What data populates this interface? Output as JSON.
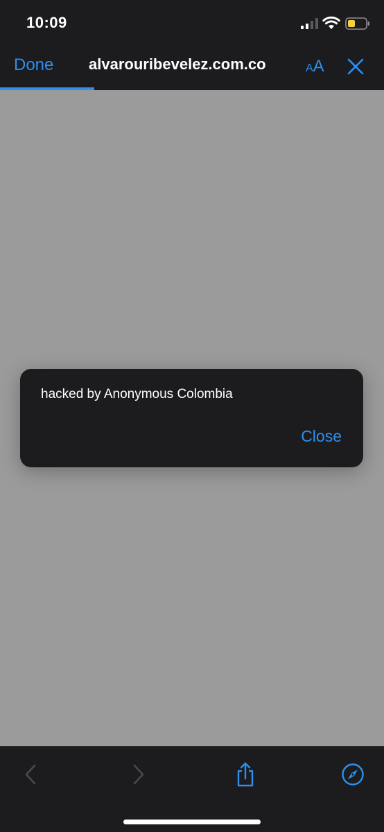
{
  "status_bar": {
    "time": "10:09",
    "icons": [
      "signal-icon",
      "wifi-icon",
      "battery-icon"
    ]
  },
  "nav_bar": {
    "done_label": "Done",
    "url": "alvarouribevelez.com.co",
    "text_size_small": "A",
    "text_size_large": "A",
    "close_icon": "close-x-icon",
    "load_progress": 0.245
  },
  "alert": {
    "message": "hacked by Anonymous Colombia",
    "close_label": "Close"
  },
  "toolbar": {
    "icons": [
      "chevron-left-icon",
      "chevron-right-icon",
      "share-icon",
      "compass-icon"
    ]
  },
  "colors": {
    "accent": "#2e8ff0",
    "chrome_background": "#1c1c1e",
    "page_background": "#9b9b9b",
    "battery_fill": "#f5d13c",
    "disabled": "#4a4a4e"
  }
}
